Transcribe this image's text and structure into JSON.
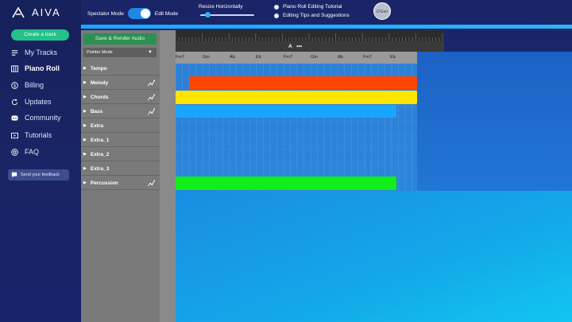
{
  "app": {
    "name": "AIVA"
  },
  "sidebar": {
    "create_label": "Create a track",
    "items": [
      {
        "label": "My Tracks",
        "icon": "music-notes-icon"
      },
      {
        "label": "Piano Roll",
        "icon": "piano-icon"
      },
      {
        "label": "Billing",
        "icon": "dollar-icon"
      },
      {
        "label": "Updates",
        "icon": "refresh-icon"
      },
      {
        "label": "Community",
        "icon": "discord-icon"
      },
      {
        "label": "Tutorials",
        "icon": "video-icon"
      },
      {
        "label": "FAQ",
        "icon": "help-icon"
      }
    ],
    "feedback_label": "Send your feedback"
  },
  "topbar": {
    "spectator_label": "Spectator Mode",
    "edit_label": "Edit Mode",
    "resize_label": "Resize Horizontally",
    "tutorial_label": "Piano Roll Editing Tutorial",
    "tips_label": "Editing Tips and Suggestions"
  },
  "panel": {
    "render_label": "Save & Render Audio",
    "pointer_label": "Pointer Mode",
    "tracks": [
      {
        "name": "Tempo",
        "automation": false
      },
      {
        "name": "Melody",
        "automation": true
      },
      {
        "name": "Chords",
        "automation": true
      },
      {
        "name": "Bass",
        "automation": true
      },
      {
        "name": "Extra",
        "automation": false
      },
      {
        "name": "Extra_1",
        "automation": false
      },
      {
        "name": "Extra_2",
        "automation": false
      },
      {
        "name": "Extra_3",
        "automation": false
      },
      {
        "name": "Percussion",
        "automation": true
      }
    ]
  },
  "roll": {
    "section_label": "A",
    "section_menu": "•••",
    "chords": [
      "Fm7",
      "Gm",
      "Ab",
      "Eb",
      "Fm7",
      "Gm",
      "Ab",
      "Fm7",
      "Eb"
    ],
    "notes": [
      {
        "track": "Melody",
        "color": "#ff4500"
      },
      {
        "track": "Chords",
        "color": "#ffe500"
      },
      {
        "track": "Bass",
        "color": "#19a4ff"
      },
      {
        "track": "Percussion",
        "color": "#11ee1a"
      }
    ]
  }
}
